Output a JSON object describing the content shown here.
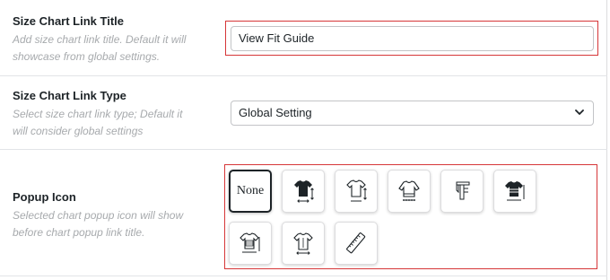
{
  "fields": {
    "link_title": {
      "label": "Size Chart Link Title",
      "description_line1": "Add size chart link title. Default it will",
      "description_line2": "showcase from global settings.",
      "value": "View Fit Guide"
    },
    "link_type": {
      "label": "Size Chart Link Type",
      "description_line1": "Select size chart link type; Default it",
      "description_line2": "will consider global settings",
      "selected": "Global Setting"
    },
    "popup_icon": {
      "label": "Popup Icon",
      "description_line1": "Selected chart popup icon will show",
      "description_line2": "before chart popup link title.",
      "none_label": "None",
      "selected_option": "none",
      "icons": [
        "none",
        "tshirt-filled-measure-icon",
        "tshirt-outline-measure-icon",
        "sweater-measure-icon",
        "caliper-icon",
        "tshirt-striped-measure-icon",
        "tshirt-chart-measure-icon",
        "tshirt-dimensions-icon",
        "ruler-icon"
      ]
    }
  },
  "colors": {
    "highlight": "#d63638",
    "label": "#1d2327",
    "description": "#a7aaad",
    "border": "#c3c4c7"
  }
}
